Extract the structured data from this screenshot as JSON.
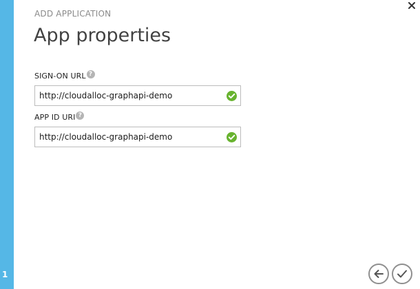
{
  "wizard": {
    "step_number": "1",
    "eyebrow": "ADD APPLICATION",
    "title": "App properties"
  },
  "fields": {
    "sign_on_url": {
      "label": "SIGN-ON URL",
      "value": "http://cloudalloc-graphapi-demo",
      "help_icon": "question-icon",
      "status_icon": "check-circle-icon"
    },
    "app_id_uri": {
      "label": "APP ID URI",
      "value": "http://cloudalloc-graphapi-demo",
      "help_icon": "question-icon",
      "status_icon": "check-circle-icon"
    }
  },
  "controls": {
    "close_icon": "close-icon",
    "back_icon": "arrow-left-icon",
    "complete_icon": "checkmark-icon"
  },
  "colors": {
    "step_bar": "#55b7e6",
    "valid": "#68b32f",
    "nav_border": "#8f8f8f",
    "help": "#b5b5b5"
  }
}
